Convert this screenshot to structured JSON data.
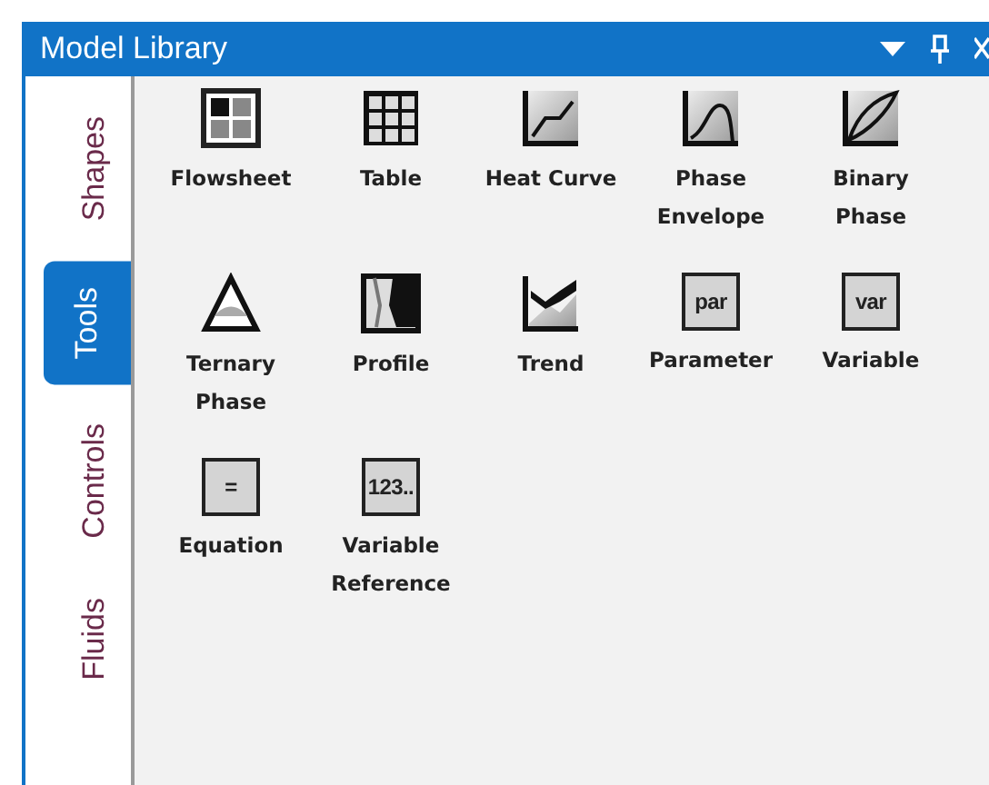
{
  "window": {
    "title": "Model Library"
  },
  "tabs": [
    {
      "label": "Shapes",
      "selected": false
    },
    {
      "label": "Tools",
      "selected": true
    },
    {
      "label": "Controls",
      "selected": false
    },
    {
      "label": "Fluids",
      "selected": false
    }
  ],
  "items": [
    {
      "kind": "flowsheet",
      "label": "Flowsheet"
    },
    {
      "kind": "table",
      "label": "Table"
    },
    {
      "kind": "heat_curve",
      "label": "Heat Curve"
    },
    {
      "kind": "phase_envelope",
      "label": "Phase Envelope"
    },
    {
      "kind": "binary_phase",
      "label": "Binary Phase"
    },
    {
      "kind": "ternary_phase",
      "label": "Ternary Phase"
    },
    {
      "kind": "profile",
      "label": "Profile"
    },
    {
      "kind": "trend",
      "label": "Trend"
    },
    {
      "kind": "text_box",
      "icon_text": "par",
      "label": "Parameter"
    },
    {
      "kind": "text_box",
      "icon_text": "var",
      "label": "Variable"
    },
    {
      "kind": "text_box",
      "icon_text": "=",
      "label": "Equation"
    },
    {
      "kind": "text_box",
      "icon_text": "123..",
      "label": "Variable Reference"
    }
  ]
}
